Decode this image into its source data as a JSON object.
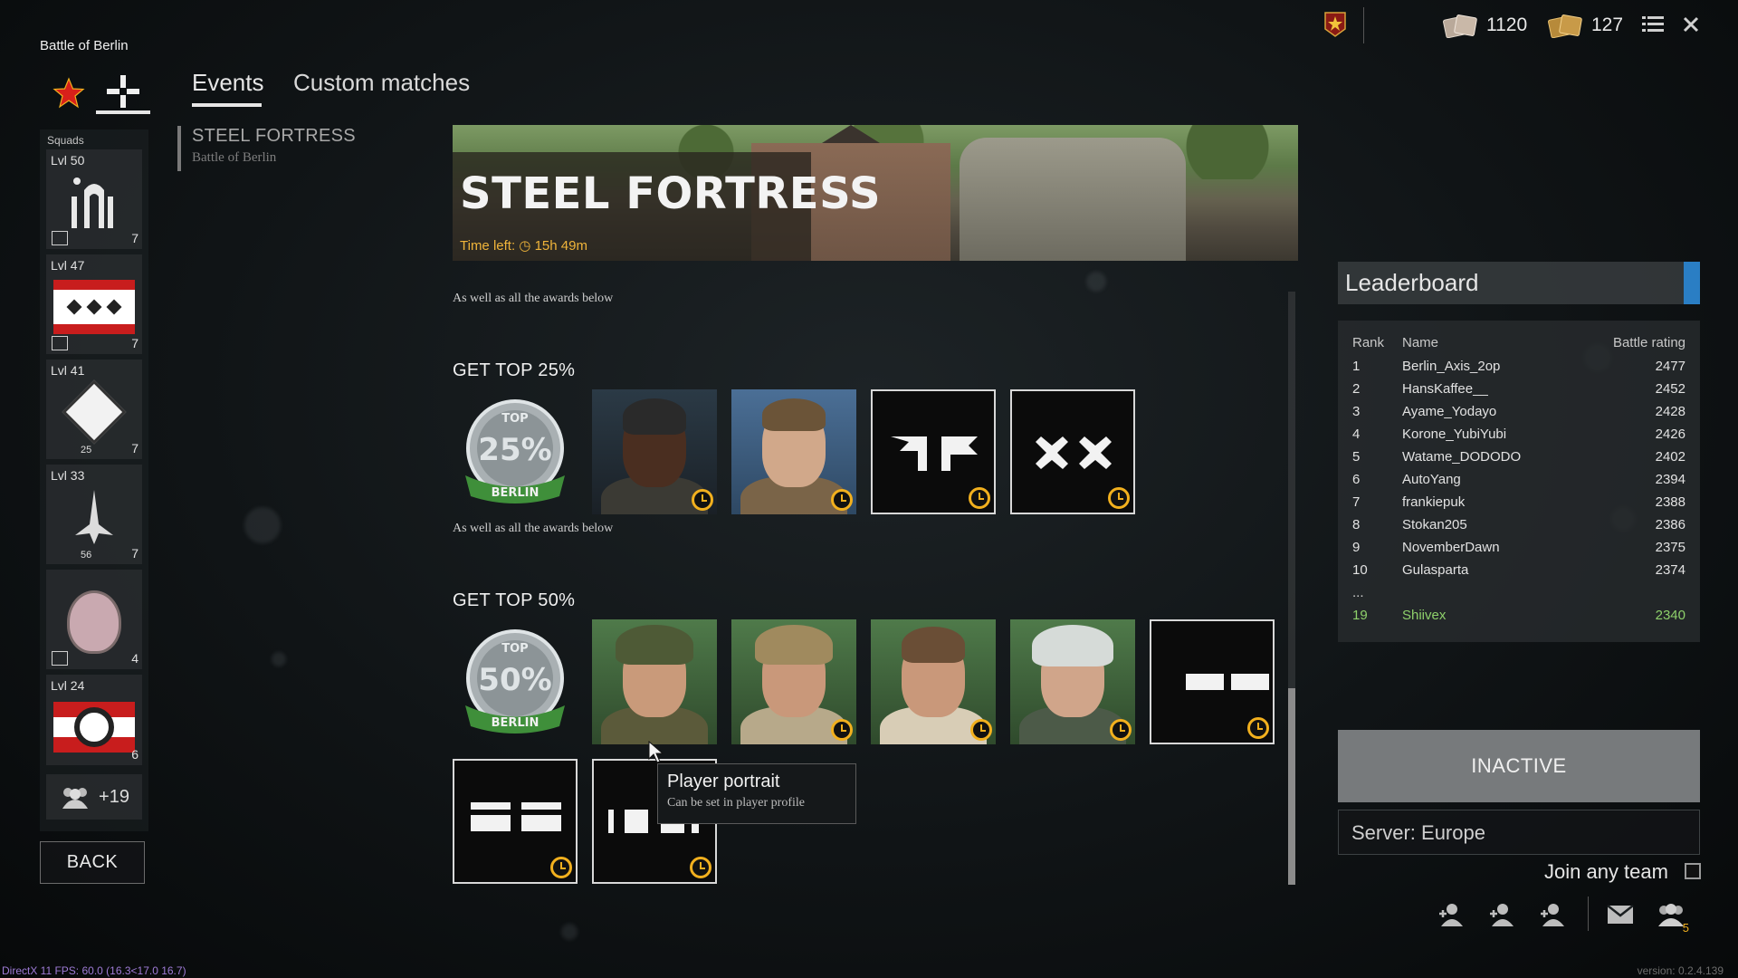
{
  "battle_title": "Battle of Berlin",
  "nav": {
    "events": "Events",
    "custom_matches": "Custom matches"
  },
  "event_list": [
    {
      "name": "STEEL FORTRESS",
      "subtitle": "Battle of Berlin"
    }
  ],
  "squads": {
    "label": "Squads",
    "items": [
      {
        "level": "Lvl 50",
        "count": "7"
      },
      {
        "level": "Lvl 47",
        "count": "7"
      },
      {
        "level": "Lvl 41",
        "count": "7",
        "badge": "25"
      },
      {
        "level": "Lvl 33",
        "count": "7",
        "badge": "56"
      },
      {
        "level": "",
        "count": "4"
      },
      {
        "level": "Lvl 24",
        "count": "6"
      }
    ],
    "more": "+19"
  },
  "back_label": "BACK",
  "banner": {
    "title": "STEEL FORTRESS",
    "time_label": "Time left:",
    "time_value": "15h 49m"
  },
  "sections": {
    "note_top": "As well as all the awards below",
    "top25": {
      "heading": "GET TOP 25%",
      "note": "As well as all the awards below",
      "medal_text": "25%"
    },
    "top50": {
      "heading": "GET TOP 50%",
      "medal_text": "50%"
    },
    "medal_banner": "BERLIN",
    "medal_top": "TOP"
  },
  "tooltip": {
    "title": "Player portrait",
    "subtitle": "Can be set in player profile"
  },
  "currency": {
    "silver": "1120",
    "gold": "127"
  },
  "leaderboard": {
    "title": "Leaderboard",
    "headers": {
      "rank": "Rank",
      "name": "Name",
      "rating": "Battle rating"
    },
    "rows": [
      {
        "rank": "1",
        "name": "Berlin_Axis_2op",
        "rating": "2477"
      },
      {
        "rank": "2",
        "name": "HansKaffee__",
        "rating": "2452"
      },
      {
        "rank": "3",
        "name": "Ayame_Yodayo",
        "rating": "2428"
      },
      {
        "rank": "4",
        "name": "Korone_YubiYubi",
        "rating": "2426"
      },
      {
        "rank": "5",
        "name": "Watame_DODODO",
        "rating": "2402"
      },
      {
        "rank": "6",
        "name": "AutoYang",
        "rating": "2394"
      },
      {
        "rank": "7",
        "name": "frankiepuk",
        "rating": "2388"
      },
      {
        "rank": "8",
        "name": "Stokan205",
        "rating": "2386"
      },
      {
        "rank": "9",
        "name": "NovemberDawn",
        "rating": "2375"
      },
      {
        "rank": "10",
        "name": "Gulasparta",
        "rating": "2374"
      }
    ],
    "ellipsis": "...",
    "me": {
      "rank": "19",
      "name": "Shiivex",
      "rating": "2340"
    }
  },
  "status_button": "INACTIVE",
  "server": "Server: Europe",
  "join_any_team": "Join any team",
  "friends_count": "5",
  "debug": {
    "fps": "DirectX 11 FPS: 60.0 (16.3<17.0 16.7)",
    "version": "version: 0.2.4.139"
  },
  "colors": {
    "accent_gold": "#f2b01e",
    "leaderboard_accent": "#2a7ec4",
    "me_green": "#8ed06b"
  },
  "icons": [
    "ussr-star-icon",
    "german-cross-icon",
    "silver-currency-icon",
    "gold-currency-icon",
    "menu-icon",
    "close-icon",
    "clock-icon",
    "add-friend-icon",
    "mail-icon",
    "friends-icon"
  ]
}
